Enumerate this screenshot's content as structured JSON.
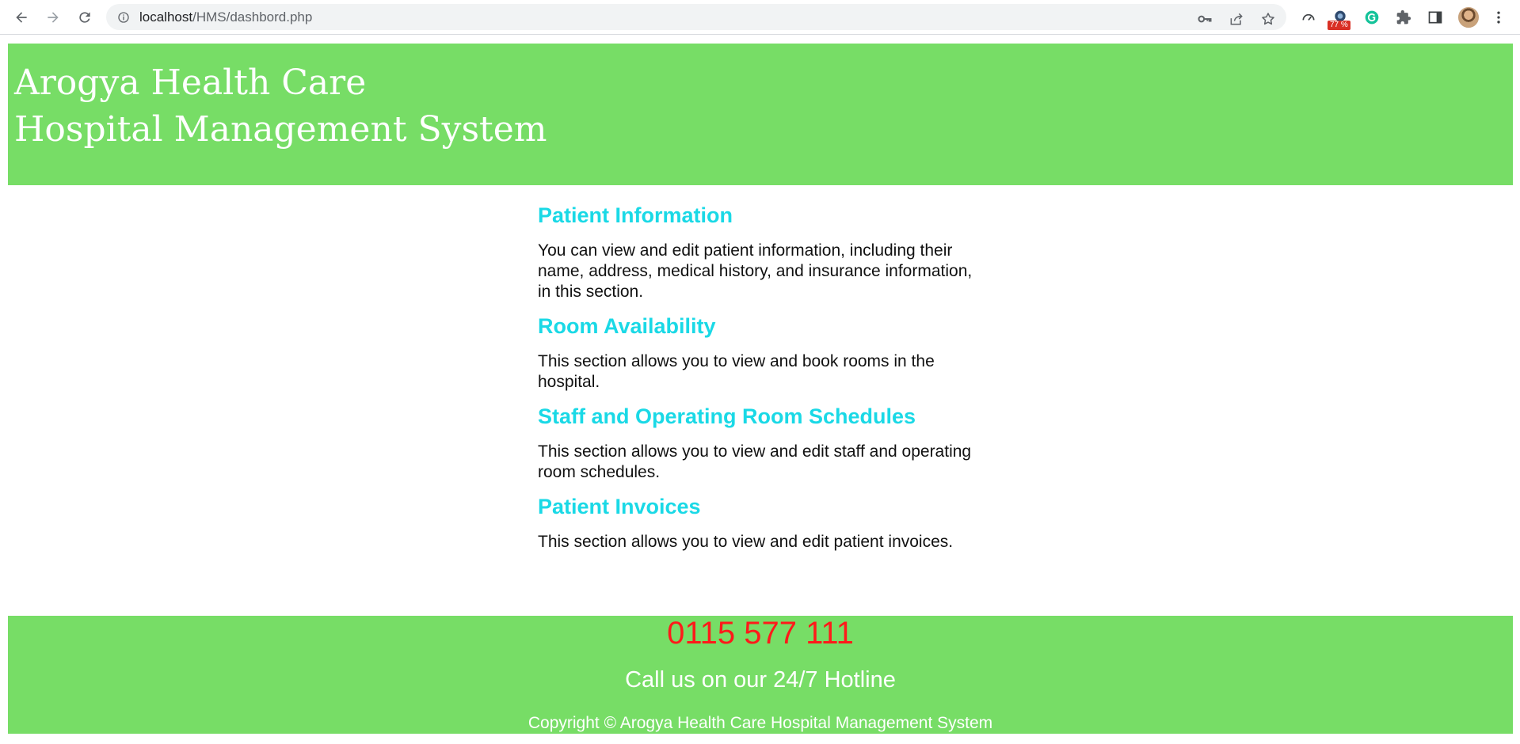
{
  "browser": {
    "url_host": "localhost",
    "url_path": "/HMS/dashbord.php",
    "extension_badge": "77 %",
    "icons": [
      "back-icon",
      "forward-icon",
      "reload-icon",
      "site-info-icon",
      "key-icon",
      "share-icon",
      "star-icon",
      "speedometer-icon",
      "extension-icon",
      "grammarly-icon",
      "puzzle-icon",
      "side-panel-icon",
      "avatar",
      "menu-icon"
    ]
  },
  "header": {
    "line1": "Arogya Health Care",
    "line2": "Hospital Management System",
    "background": "#77dd66"
  },
  "sections": [
    {
      "title": "Patient Information",
      "text": "You can view and edit patient information, including their name, address, medical history, and insurance information, in this section."
    },
    {
      "title": "Room Availability",
      "text": "This section allows you to view and book rooms in the hospital."
    },
    {
      "title": "Staff and Operating Room Schedules",
      "text": "This section allows you to view and edit staff and operating room schedules."
    },
    {
      "title": "Patient Invoices",
      "text": "This section allows you to view and edit patient invoices."
    }
  ],
  "footer": {
    "phone": "0115 577 111",
    "hotline_label": "Call us on our 24/7 Hotline",
    "copyright": "Copyright © Arogya Health Care Hospital Management System"
  },
  "colors": {
    "accent_green": "#77dd66",
    "heading_cyan": "#1ad9e6",
    "phone_red": "#ff1a1a"
  }
}
